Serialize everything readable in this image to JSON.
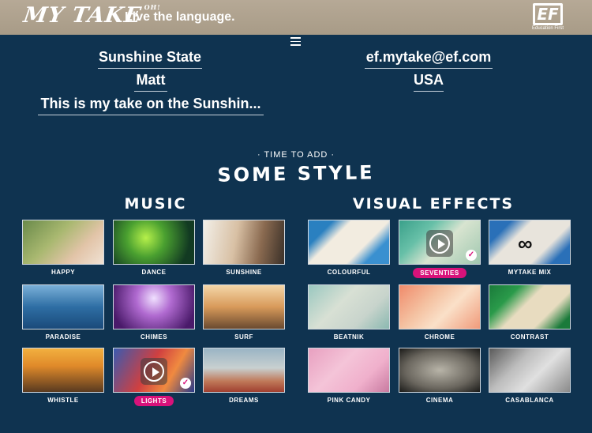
{
  "header": {
    "logo_text": "MY TAKE",
    "logo_mark": "OH!",
    "tagline": "Live the language.",
    "ef_mark": "EF",
    "ef_sub": "Education First"
  },
  "menu_icon": "hamburger-icon",
  "info": {
    "title": "Sunshine State",
    "email": "ef.mytake@ef.com",
    "name": "Matt",
    "country": "USA",
    "description": "This is my take on the Sunshin..."
  },
  "kicker": "· TIME TO ADD ·",
  "headline": "SOME STYLE",
  "music": {
    "title": "MUSIC",
    "items": [
      {
        "label": "HAPPY"
      },
      {
        "label": "DANCE"
      },
      {
        "label": "SUNSHINE"
      },
      {
        "label": "PARADISE"
      },
      {
        "label": "CHIMES"
      },
      {
        "label": "SURF"
      },
      {
        "label": "WHISTLE"
      },
      {
        "label": "LIGHTS"
      },
      {
        "label": "DREAMS"
      }
    ],
    "selected": "LIGHTS"
  },
  "visual_effects": {
    "title": "VISUAL EFFECTS",
    "items": [
      {
        "label": "COLOURFUL"
      },
      {
        "label": "SEVENTIES"
      },
      {
        "label": "MYTAKE MIX"
      },
      {
        "label": "BEATNIK"
      },
      {
        "label": "CHROME"
      },
      {
        "label": "CONTRAST"
      },
      {
        "label": "PINK CANDY"
      },
      {
        "label": "CINEMA"
      },
      {
        "label": "CASABLANCA"
      }
    ],
    "selected": "SEVENTIES"
  },
  "colors": {
    "background": "#0f3350",
    "header": "#b0a38f",
    "selected_badge": "#d8127a"
  }
}
